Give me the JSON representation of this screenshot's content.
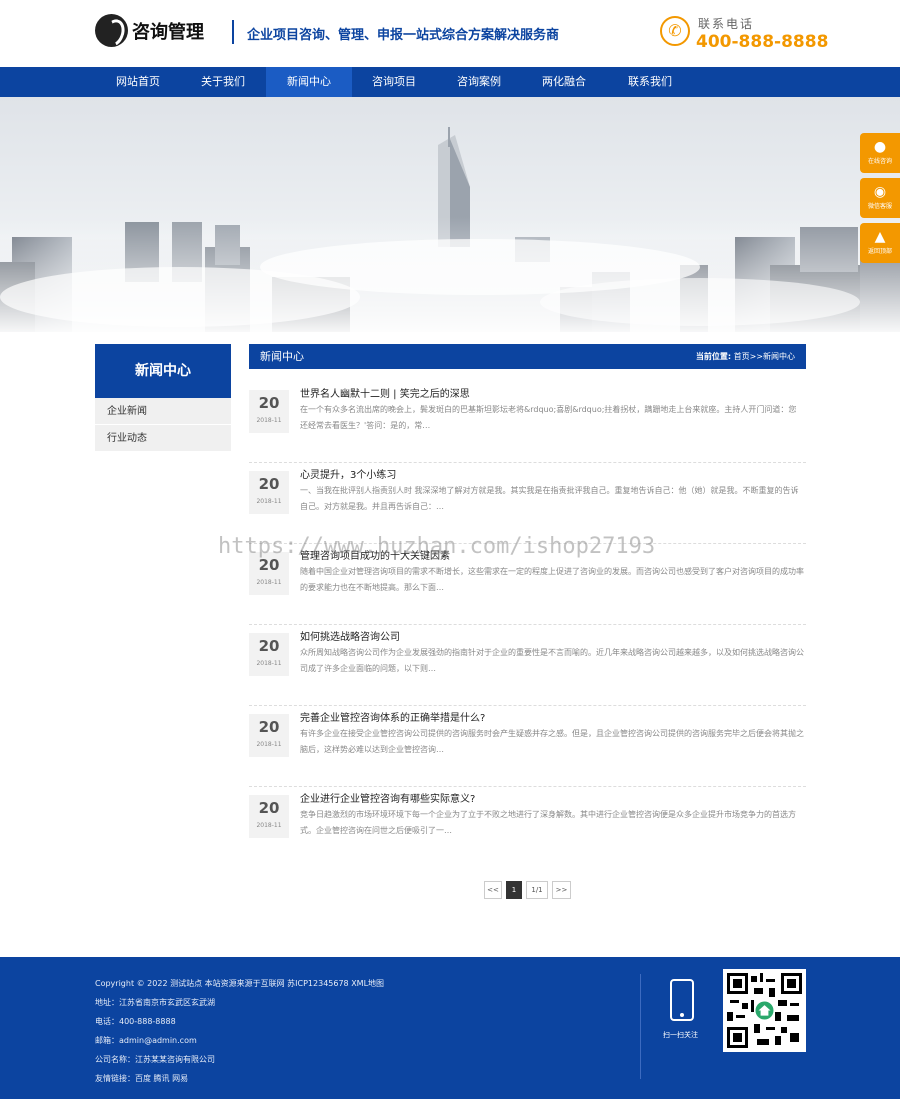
{
  "header": {
    "logo_text": "咨询管理",
    "slogan": "企业项目咨询、管理、申报一站式综合方案解决服务商",
    "phone_label": "联系电话",
    "phone_number": "400-888-8888"
  },
  "nav": {
    "items": [
      {
        "label": "网站首页"
      },
      {
        "label": "关于我们"
      },
      {
        "label": "新闻中心"
      },
      {
        "label": "咨询项目"
      },
      {
        "label": "咨询案例"
      },
      {
        "label": "两化融合"
      },
      {
        "label": "联系我们"
      }
    ],
    "active_index": 2
  },
  "float_buttons": [
    {
      "label": "在线咨询",
      "icon": "qq-icon"
    },
    {
      "label": "微信客服",
      "icon": "wechat-icon"
    },
    {
      "label": "返回顶部",
      "icon": "top-icon"
    }
  ],
  "sidebar": {
    "title": "新闻中心",
    "items": [
      {
        "label": "企业新闻"
      },
      {
        "label": "行业动态"
      }
    ]
  },
  "main": {
    "title": "新闻中心",
    "breadcrumb_label": "当前位置:",
    "breadcrumb_path": "首页>>新闻中心"
  },
  "news": [
    {
      "day": "20",
      "ym": "2018-11",
      "title": "世界名人幽默十二则 | 笑完之后的深思",
      "desc": "在一个有众多名流出席的晚会上，鬓发斑白的巴基斯坦影坛老将&rdquo;喜剧&rdquo;拄着拐杖，蹒跚地走上台来就座。主持人开门问道：您还经常去看医生？'答问：是的，常…"
    },
    {
      "day": "20",
      "ym": "2018-11",
      "title": "心灵提升，3个小练习",
      "desc": "一、当我在批评别人指责别人时 我深深地了解对方就是我。其实我是在指责批评我自己。重复地告诉自己：他（她）就是我。不断重复的告诉自己。对方就是我。并且再告诉自己：…"
    },
    {
      "day": "20",
      "ym": "2018-11",
      "title": "管理咨询项目成功的十大关键因素",
      "desc": "随着中国企业对管理咨询项目的需求不断增长，这些需求在一定的程度上促进了咨询业的发展。而咨询公司也感受到了客户对咨询项目的成功率的要求能力也在不断地提高。那么下面…"
    },
    {
      "day": "20",
      "ym": "2018-11",
      "title": "如何挑选战略咨询公司",
      "desc": "众所周知战略咨询公司作为企业发展强劲的指南针对于企业的重要性是不言而喻的。近几年来战略咨询公司越来越多，以及如何挑选战略咨询公司成了许多企业面临的问题，以下则…"
    },
    {
      "day": "20",
      "ym": "2018-11",
      "title": "完善企业管控咨询体系的正确举措是什么?",
      "desc": "有许多企业在接受企业管控咨询公司提供的咨询服务时会产生疑惑并存之感。但是，且企业管控咨询公司提供的咨询服务完毕之后便会将其抛之脑后，这样势必难以达到企业管控咨询…"
    },
    {
      "day": "20",
      "ym": "2018-11",
      "title": "企业进行企业管控咨询有哪些实际意义?",
      "desc": "竞争日趋激烈的市场环境环境下每一个企业为了立于不败之地进行了深身解数。其中进行企业管控咨询便是众多企业提升市场竞争力的首选方式。企业管控咨询在问世之后便吸引了一…"
    }
  ],
  "pagination": {
    "prev": "<<",
    "current": "1",
    "total": "1/1",
    "next": ">>"
  },
  "watermark": "https://www.huzhan.com/ishop27193",
  "footer": {
    "copyright": "Copyright © 2022 测试站点 本站资源来源于互联网   苏ICP12345678 XML地图",
    "address": "地址：江苏省南京市玄武区玄武湖",
    "phone": "电话：400-888-8888",
    "email": "邮箱：admin@admin.com",
    "company": "公司名称：江苏某某咨询有限公司",
    "links": "友情链接：百度  腾讯  网易",
    "follow": "扫一扫关注"
  },
  "colors": {
    "primary": "#0c44a0",
    "accent": "#f39800"
  }
}
